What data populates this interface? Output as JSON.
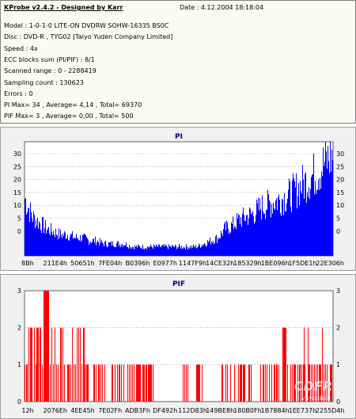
{
  "info": {
    "title": "KProbe v2.4.2 - Designed by Karr",
    "date": "Date : 4.12.2004 18:18:04",
    "lines": [
      "Model : 1-0-1-0 LITE-ON DVDRW SOHW-16335 BS0C",
      "Disc : DVD-R , TYG02 [Taiyo Yuden Company Limited]",
      "Speed : 4x",
      "ECC blocks sum (PI/PIF) : 8/1",
      "Scanned range : 0 - 2288419",
      "Sampling count : 130623",
      "Errors : 0",
      "PI Max= 34 , Average= 4,14 , Total= 69370",
      "PIF Max= 3 , Average= 0,00 , Total= 500"
    ]
  },
  "watermark": {
    "text": "CDFR",
    "url": "www.cdr.cz"
  },
  "colors": {
    "pi_fill": "#0000ff",
    "pif_fill": "#ff0000",
    "grid": "#8080a0",
    "title": "#000080"
  },
  "chart_data": [
    {
      "type": "bar",
      "title": "PI",
      "ylim": [
        0,
        35
      ],
      "yticks": [
        "30",
        "25",
        "20",
        "15",
        "10",
        "5",
        "0"
      ],
      "xticks": [
        "8Bh",
        "211E4h",
        "50651h",
        "7FE04h",
        "B0396h",
        "E0977h",
        "1147F9h",
        "14CE32h",
        "185329h",
        "1BE096h",
        "1F5DE1h",
        "22E306h"
      ],
      "series": [
        {
          "values": [
            19,
            13,
            11,
            9,
            8,
            7,
            7,
            6,
            6,
            5,
            5,
            4,
            4,
            4,
            4,
            3,
            3,
            3,
            3,
            3,
            3,
            3,
            3,
            3,
            3,
            4,
            5,
            6,
            9,
            10,
            12,
            13,
            14,
            16,
            17,
            18,
            19,
            20,
            22,
            24,
            26,
            28,
            31,
            33
          ]
        }
      ]
    },
    {
      "type": "bar",
      "title": "PIF",
      "ylim": [
        0,
        3
      ],
      "yticks": [
        "3",
        "2",
        "1",
        "0"
      ],
      "xticks": [
        "12h",
        "2076Eh",
        "4EE45h",
        "7E02Fh",
        "ADB3Fh",
        "DF492h",
        "112D83h",
        "149BE8h",
        "180B0Fh",
        "1B7884h",
        "1EE737h",
        "2255D4h"
      ],
      "series": [
        {
          "values": [
            1,
            2,
            2,
            3,
            2,
            2,
            1,
            2,
            2,
            1,
            1,
            1,
            1,
            1,
            1,
            1,
            1,
            1,
            1,
            0,
            0,
            0,
            0,
            1,
            0,
            1,
            0,
            0,
            1,
            1,
            1,
            1,
            1,
            0,
            1,
            1,
            1,
            2,
            1,
            1,
            2,
            1,
            1,
            2,
            1
          ]
        }
      ]
    }
  ]
}
